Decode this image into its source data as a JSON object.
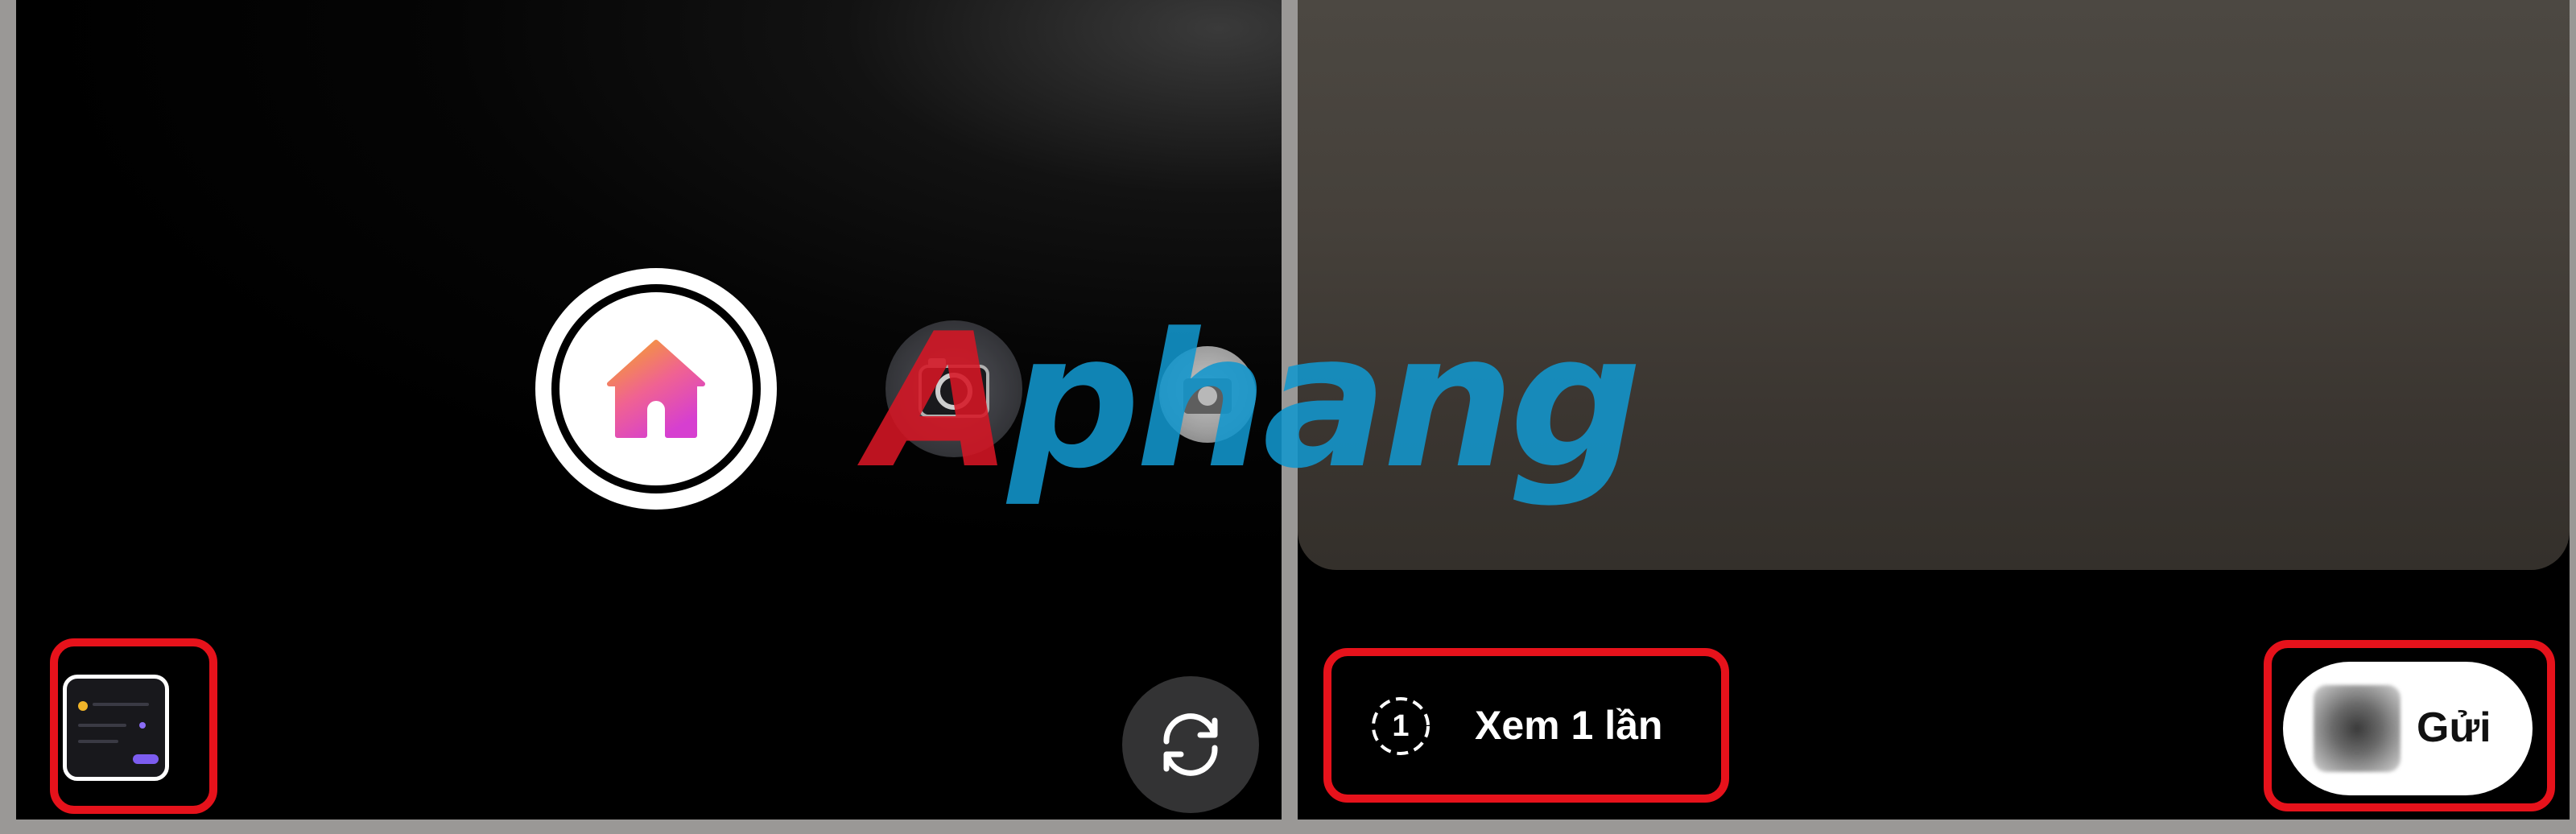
{
  "left_screen": {
    "capture_button": {
      "icon": "house-icon"
    },
    "modes": [
      {
        "icon": "camera-icon"
      },
      {
        "icon": "photo-icon"
      }
    ],
    "gallery_thumbnail": {
      "icon": "gallery-icon"
    },
    "flip_camera": {
      "icon": "flip-camera-icon"
    }
  },
  "right_screen": {
    "view_once": {
      "number": "1",
      "label": "Xem 1 lần"
    },
    "send": {
      "label": "Gửi"
    }
  },
  "watermark": {
    "text_a": "A",
    "text_b": "phang"
  },
  "colors": {
    "highlight": "#e6121b",
    "capture_gradient_top": "#f5a623",
    "capture_gradient_bottom": "#e040fb",
    "watermark_red": "#d61624",
    "watermark_blue": "#1296cd"
  }
}
